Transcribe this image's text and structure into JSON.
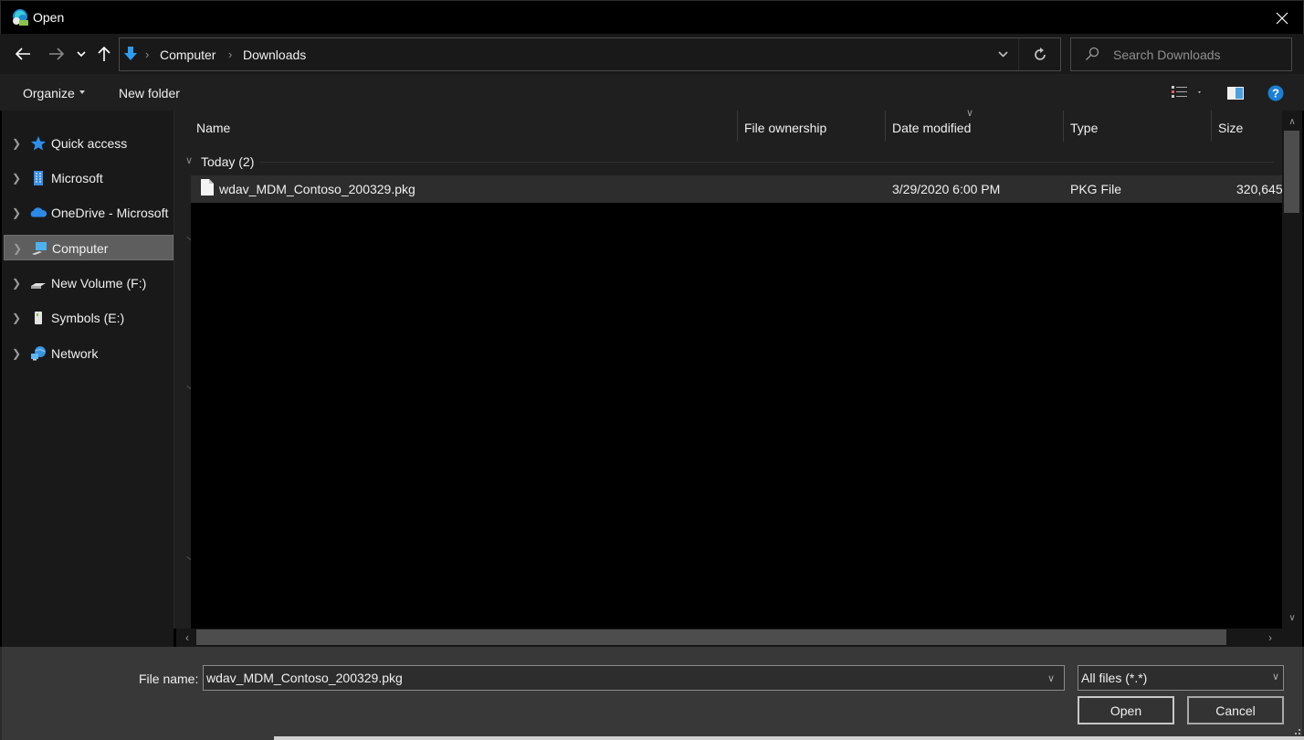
{
  "window": {
    "title": "Open",
    "close_label": "Close"
  },
  "nav": {
    "back_label": "Back",
    "forward_label": "Forward",
    "recent_label": "Recent locations",
    "up_label": "Up"
  },
  "address": {
    "breadcrumbs": [
      "Computer",
      "Downloads"
    ],
    "refresh_label": "Refresh"
  },
  "search": {
    "placeholder": "Search Downloads",
    "value": ""
  },
  "toolbar": {
    "organize_label": "Organize",
    "new_folder_label": "New folder",
    "view_icon": "details-view-icon",
    "preview_icon": "preview-pane-icon",
    "help_icon": "help-icon"
  },
  "sidebar": {
    "items": [
      {
        "label": "Quick access",
        "icon": "star-icon",
        "selected": false
      },
      {
        "label": "Microsoft",
        "icon": "building-icon",
        "selected": false
      },
      {
        "label": "OneDrive - Microsoft",
        "icon": "cloud-icon",
        "selected": false
      },
      {
        "label": "Computer",
        "icon": "computer-icon",
        "selected": true
      },
      {
        "label": "New Volume (F:)",
        "icon": "drive-icon",
        "selected": false
      },
      {
        "label": "Symbols (E:)",
        "icon": "removable-drive-icon",
        "selected": false
      },
      {
        "label": "Network",
        "icon": "network-icon",
        "selected": false
      }
    ]
  },
  "columns": [
    "Name",
    "File ownership",
    "Date modified",
    "Type",
    "Size"
  ],
  "groups": [
    {
      "label": "Today (2)",
      "files": [
        {
          "name": "wdav_MDM_Contoso_200329.pkg",
          "ownership": "",
          "date_modified": "3/29/2020 6:00 PM",
          "type": "PKG File",
          "size": "320,645"
        }
      ]
    }
  ],
  "footer": {
    "file_name_label": "File name:",
    "file_name_value": "wdav_MDM_Contoso_200329.pkg",
    "file_type_value": "All files (*.*)",
    "open_label": "Open",
    "cancel_label": "Cancel"
  },
  "colors": {
    "accent_blue": "#1e90ff",
    "selected_bg": "#5e5e5e"
  }
}
